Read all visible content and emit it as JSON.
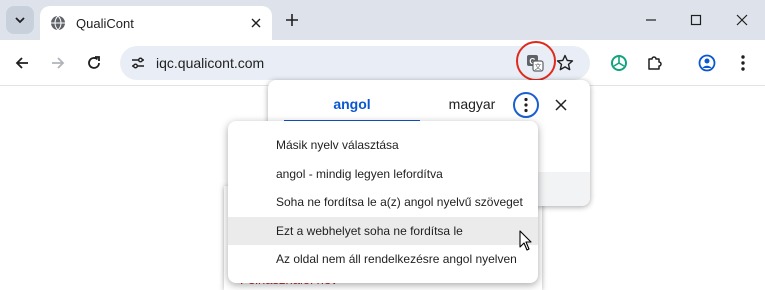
{
  "browser": {
    "tab": {
      "title": "QualiCont"
    },
    "url": "iqc.qualicont.com"
  },
  "translate": {
    "tabs": [
      "angol",
      "magyar"
    ],
    "active_tab": "angol"
  },
  "page": {
    "peek_text": "Felhasználói név"
  },
  "menu": {
    "items": [
      "Másik nyelv választása",
      "angol - mindig legyen lefordítva",
      "Soha ne fordítsa le a(z) angol nyelvű szöveget",
      "Ezt a webhelyet soha ne fordítsa le",
      "Az oldal nem áll rendelkezésre angol nyelven"
    ],
    "hovered_index": 3
  },
  "colors": {
    "accent": "#0b57d0",
    "highlight_ring": "#e02a1f",
    "tabstrip": "#dee3eb",
    "omnibox": "#e9eef6"
  }
}
